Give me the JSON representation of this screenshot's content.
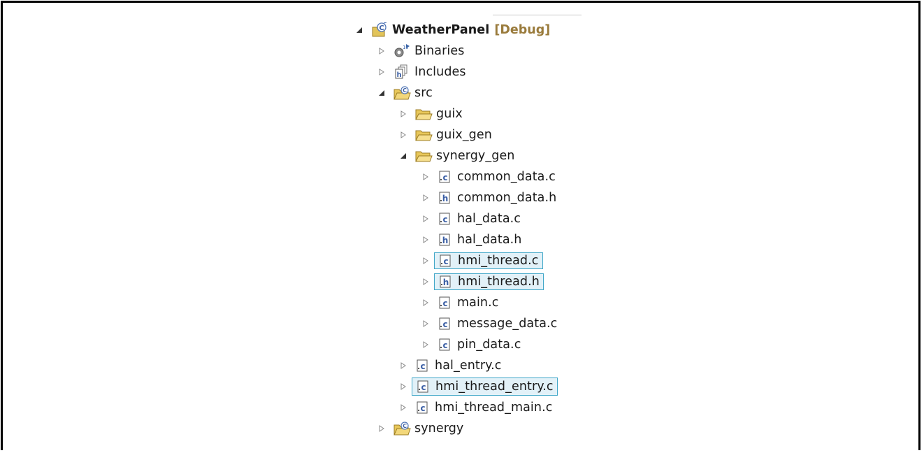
{
  "project": {
    "name": "WeatherPanel",
    "config": "[Debug]",
    "icon": "c-project-icon"
  },
  "tree": [
    {
      "name": "binaries",
      "label": "Binaries",
      "icon": "binaries-icon",
      "expanded": false
    },
    {
      "name": "includes",
      "label": "Includes",
      "icon": "includes-icon",
      "expanded": false
    },
    {
      "name": "src",
      "label": "src",
      "icon": "source-folder-icon",
      "expanded": true
    },
    {
      "name": "guix",
      "label": "guix",
      "icon": "folder-icon",
      "expanded": false
    },
    {
      "name": "guix_gen",
      "label": "guix_gen",
      "icon": "folder-icon",
      "expanded": false
    },
    {
      "name": "synergy_gen",
      "label": "synergy_gen",
      "icon": "folder-icon",
      "expanded": true
    },
    {
      "name": "common_data_c",
      "label": "common_data.c",
      "icon": "c-file-icon",
      "expanded": false
    },
    {
      "name": "common_data_h",
      "label": "common_data.h",
      "icon": "h-file-icon",
      "expanded": false
    },
    {
      "name": "hal_data_c",
      "label": "hal_data.c",
      "icon": "c-file-icon",
      "expanded": false
    },
    {
      "name": "hal_data_h",
      "label": "hal_data.h",
      "icon": "h-file-icon",
      "expanded": false
    },
    {
      "name": "hmi_thread_c",
      "label": "hmi_thread.c",
      "icon": "c-file-icon",
      "expanded": false,
      "selected": true
    },
    {
      "name": "hmi_thread_h",
      "label": "hmi_thread.h",
      "icon": "h-file-icon",
      "expanded": false,
      "selected": true
    },
    {
      "name": "main_c",
      "label": "main.c",
      "icon": "c-file-icon",
      "expanded": false
    },
    {
      "name": "message_data_c",
      "label": "message_data.c",
      "icon": "c-file-icon",
      "expanded": false
    },
    {
      "name": "pin_data_c",
      "label": "pin_data.c",
      "icon": "c-file-icon",
      "expanded": false
    },
    {
      "name": "hal_entry_c",
      "label": "hal_entry.c",
      "icon": "c-file-icon",
      "expanded": false
    },
    {
      "name": "hmi_thread_entry_c",
      "label": "hmi_thread_entry.c",
      "icon": "c-file-icon",
      "expanded": false,
      "selected": true
    },
    {
      "name": "hmi_thread_main_c",
      "label": "hmi_thread_main.c",
      "icon": "c-file-icon",
      "expanded": false
    },
    {
      "name": "synergy",
      "label": "synergy",
      "icon": "source-folder-icon",
      "expanded": false
    }
  ],
  "colors": {
    "selection_border": "#41a7c8",
    "selection_fill": "#e2f1f8",
    "config_text": "#9a7b3c"
  }
}
